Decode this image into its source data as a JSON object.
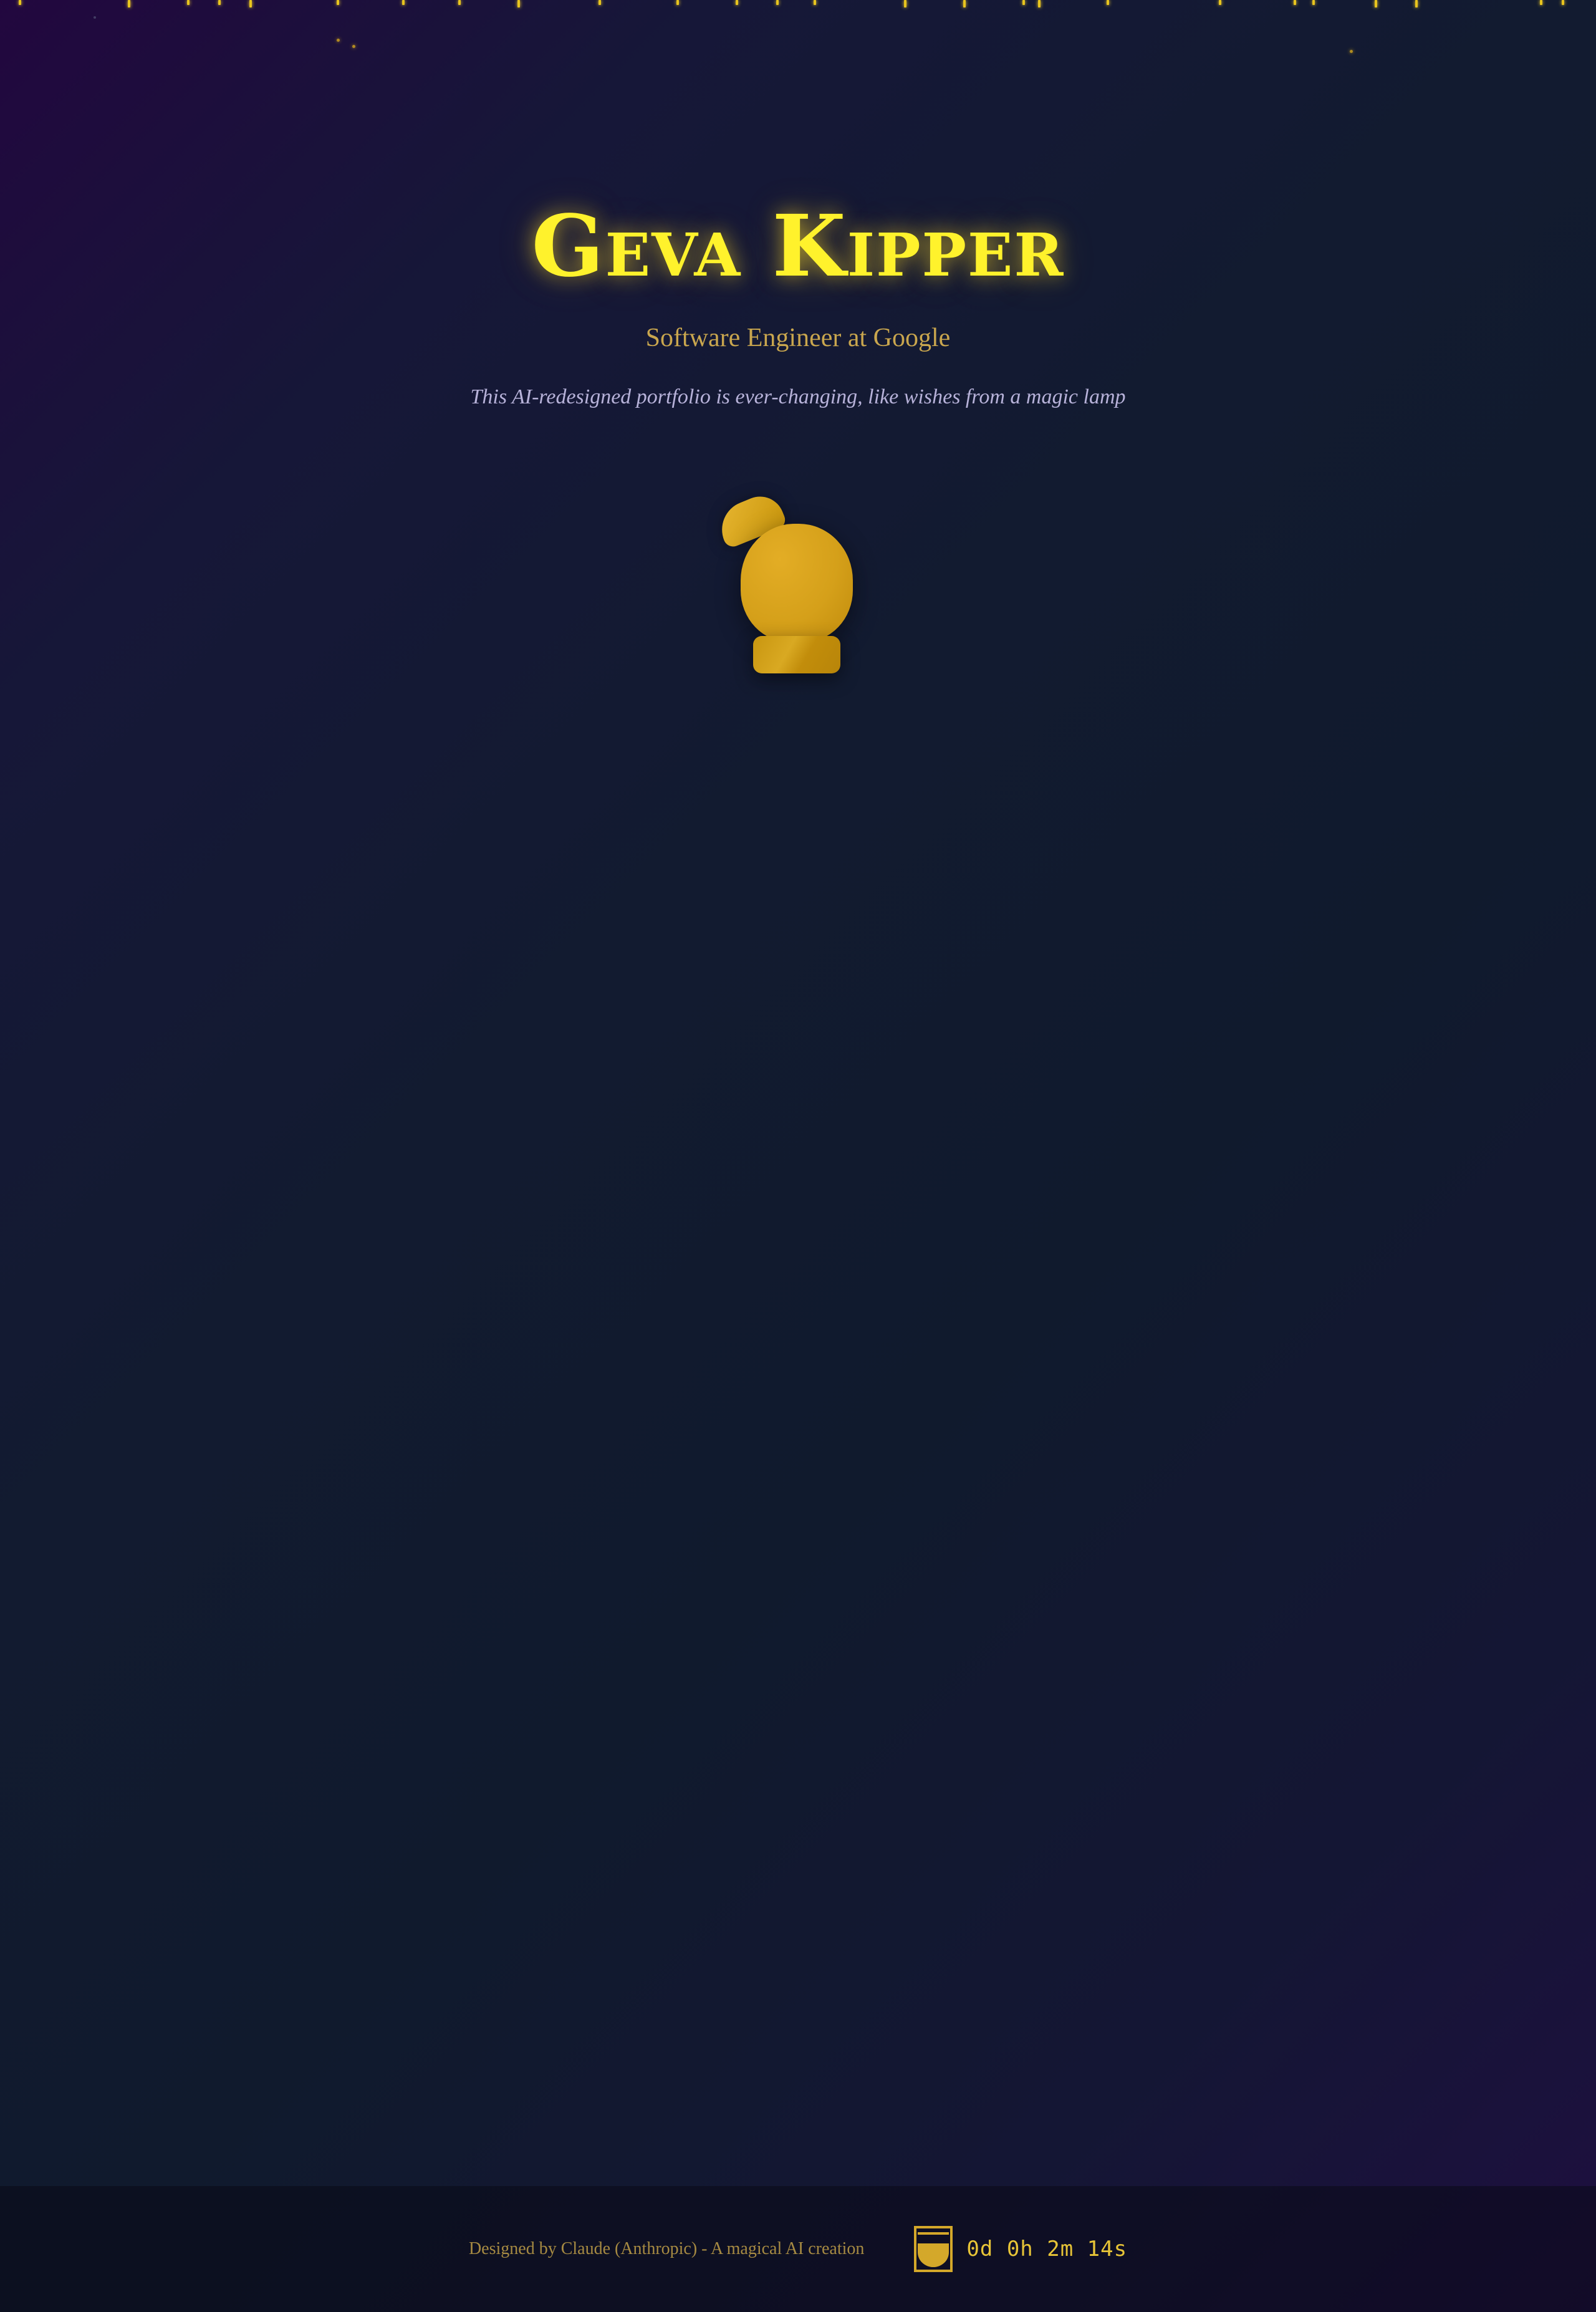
{
  "header": {
    "name": "Geva Kipper",
    "subtitle": "Software Engineer at Google",
    "tagline": "This AI-redesigned portfolio is ever-changing, like wishes from a magic lamp"
  },
  "lamp": {
    "icon": "magic-lamp-icon"
  },
  "footer": {
    "credit": "Designed by Claude (Anthropic) - A magical AI creation",
    "timer_icon": "hourglass-icon",
    "timer": "0d 0h 2m 14s"
  },
  "colors": {
    "accent": "#fff22c",
    "gold": "#d4a82a",
    "subtitle": "#c9a64e",
    "tagline": "#b7b2d9"
  }
}
